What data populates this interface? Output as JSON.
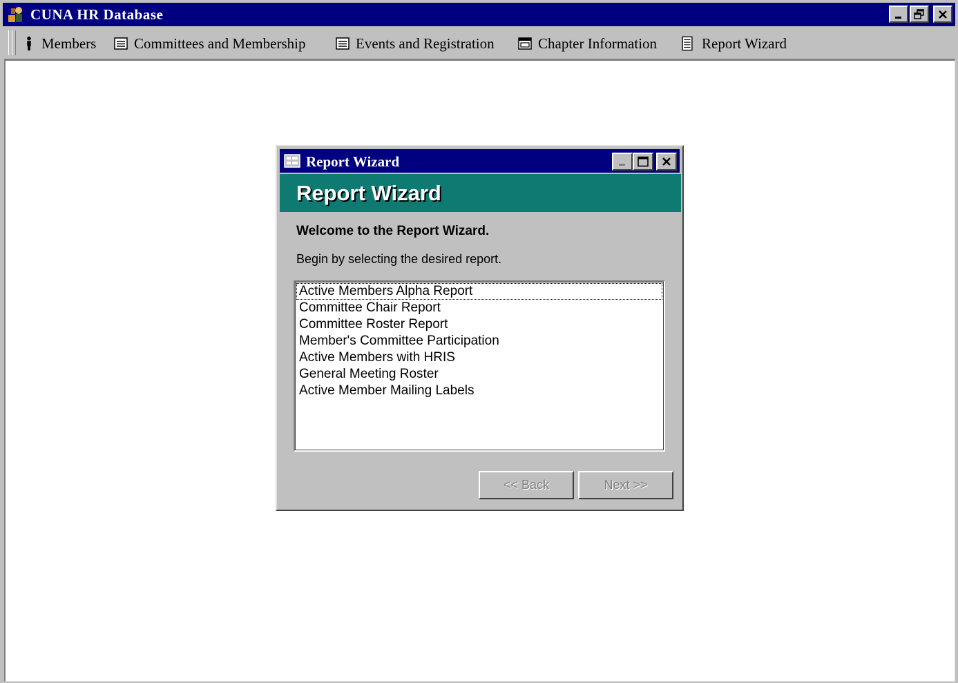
{
  "app": {
    "title": "CUNA HR Database",
    "icon": "app-logo-icon",
    "window_controls": [
      "minimize",
      "restore",
      "close"
    ]
  },
  "toolbar": {
    "items": [
      {
        "label": "Members",
        "icon": "person-icon"
      },
      {
        "label": "Committees and Membership",
        "icon": "form-icon"
      },
      {
        "label": "Events and Registration",
        "icon": "form-icon"
      },
      {
        "label": "Chapter Information",
        "icon": "window-icon"
      },
      {
        "label": "Report Wizard",
        "icon": "report-icon"
      }
    ]
  },
  "dialog": {
    "title": "Report Wizard",
    "banner": "Report Wizard",
    "welcome": "Welcome to the Report Wizard.",
    "instructions": "Begin by selecting the desired report.",
    "reports": [
      "Active Members Alpha Report",
      "Committee Chair Report",
      "Committee Roster Report",
      "Member's Committee Participation",
      "Active Members with HRIS",
      "General Meeting Roster",
      "Active Member Mailing Labels"
    ],
    "back_label": "<< Back",
    "next_label": "Next >>",
    "colors": {
      "banner": "#0e7a72",
      "titlebar": "#000080"
    }
  }
}
